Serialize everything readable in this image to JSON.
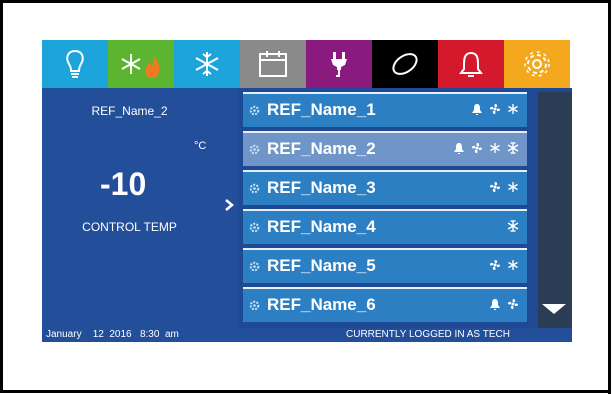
{
  "tabs": [
    {
      "name": "lightbulb-icon",
      "color": "#1da4db"
    },
    {
      "name": "heat-cool-icon",
      "color": "#5cb531"
    },
    {
      "name": "snowflake-icon",
      "color": "#1da4db"
    },
    {
      "name": "calendar-icon",
      "color": "#8a8a8a"
    },
    {
      "name": "plug-icon",
      "color": "#8b1a7f"
    },
    {
      "name": "oval-icon",
      "color": "#000000"
    },
    {
      "name": "bell-icon",
      "color": "#d4192c"
    },
    {
      "name": "gear-icon",
      "color": "#f4a81d"
    }
  ],
  "left_panel": {
    "ref_name": "REF_Name_2",
    "unit": "°C",
    "temperature": "-10",
    "temp_label": "CONTROL TEMP"
  },
  "list": {
    "rows": [
      {
        "label": "REF_Name_1",
        "icons": [
          "bell",
          "fan",
          "snow"
        ],
        "selected": false
      },
      {
        "label": "REF_Name_2",
        "icons": [
          "bell",
          "fan",
          "snow",
          "defrost"
        ],
        "selected": true
      },
      {
        "label": "REF_Name_3",
        "icons": [
          "fan",
          "snow"
        ],
        "selected": false
      },
      {
        "label": "REF_Name_4",
        "icons": [
          "defrost"
        ],
        "selected": false
      },
      {
        "label": "REF_Name_5",
        "icons": [
          "fan",
          "snow"
        ],
        "selected": false
      },
      {
        "label": "REF_Name_6",
        "icons": [
          "bell",
          "fan"
        ],
        "selected": false
      }
    ]
  },
  "status": {
    "date": "January    12  2016   8:30  am",
    "user": "CURRENTLY LOGGED IN AS TECH"
  }
}
